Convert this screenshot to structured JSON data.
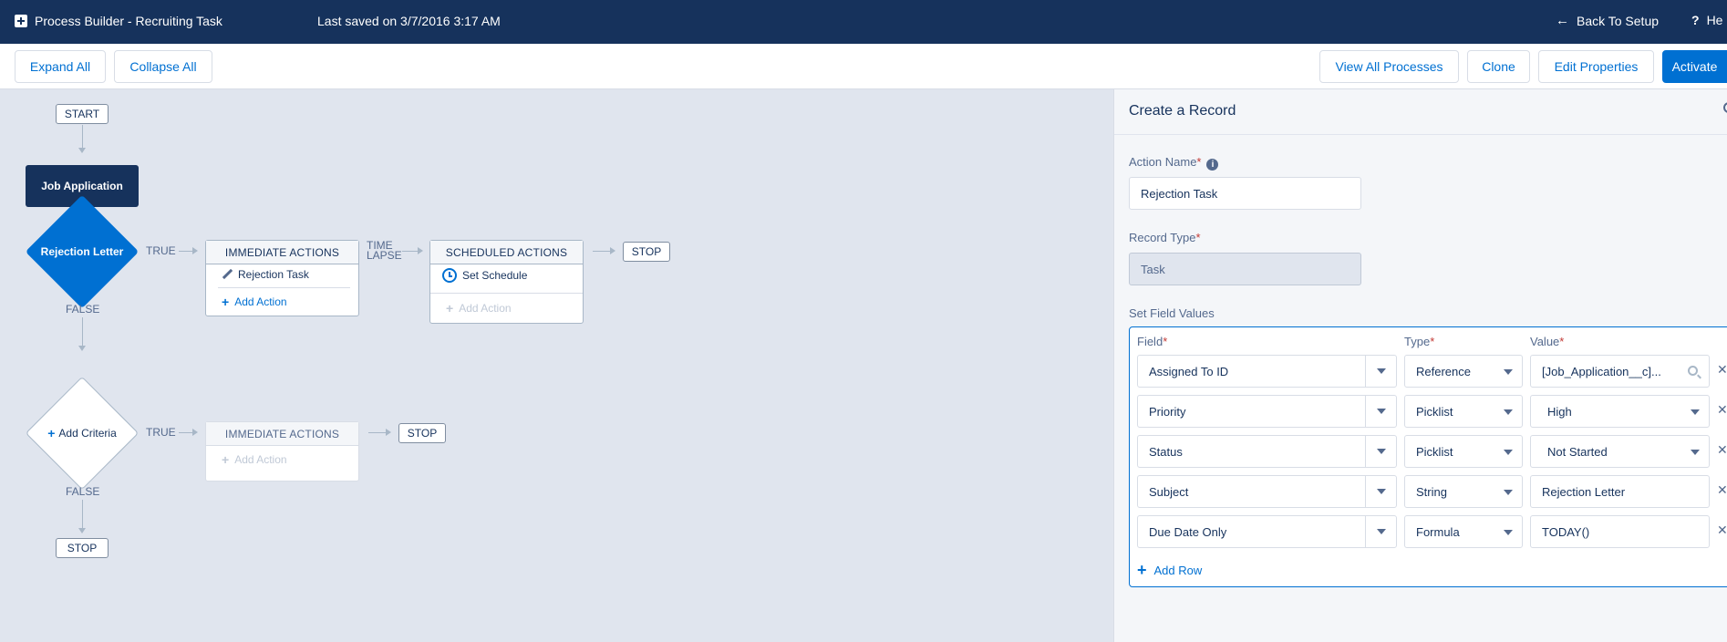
{
  "topbar": {
    "app_title": "Process Builder - Recruiting Task",
    "last_saved": "Last saved on 3/7/2016 3:17 AM",
    "back_label": "Back To Setup",
    "help_label": "He"
  },
  "toolbar": {
    "expand_all": "Expand All",
    "collapse_all": "Collapse All",
    "view_all": "View All Processes",
    "clone": "Clone",
    "edit_properties": "Edit Properties",
    "activate": "Activate"
  },
  "canvas": {
    "start": "START",
    "object_node": "Job Application",
    "criteria_1": "Rejection Letter",
    "true_label": "TRUE",
    "false_label": "FALSE",
    "immediate_actions": "IMMEDIATE ACTIONS",
    "scheduled_actions": "SCHEDULED ACTIONS",
    "time_lapse_1": "TIME",
    "time_lapse_2": "LAPSE",
    "rejection_task": "Rejection Task",
    "add_action": "Add Action",
    "set_schedule": "Set Schedule",
    "stop": "STOP",
    "add_criteria": "Add Criteria"
  },
  "panel": {
    "title": "Create a Record",
    "action_name_label": "Action Name",
    "action_name_value": "Rejection Task",
    "record_type_label": "Record Type",
    "record_type_value": "Task",
    "set_field_values": "Set Field Values",
    "col_field": "Field",
    "col_type": "Type",
    "col_value": "Value",
    "rows": [
      {
        "field": "Assigned To ID",
        "type": "Reference",
        "value": "[Job_Application__c]..."
      },
      {
        "field": "Priority",
        "type": "Picklist",
        "value": "High"
      },
      {
        "field": "Status",
        "type": "Picklist",
        "value": "Not Started"
      },
      {
        "field": "Subject",
        "type": "String",
        "value": "Rejection Letter"
      },
      {
        "field": "Due Date Only",
        "type": "Formula",
        "value": "TODAY()"
      }
    ],
    "add_row": "Add Row"
  }
}
